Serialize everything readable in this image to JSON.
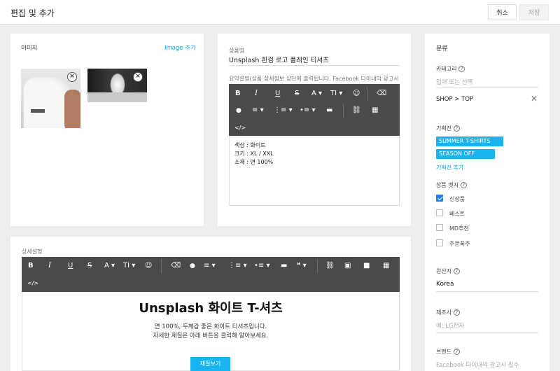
{
  "header": {
    "title": "편집 및 추가",
    "cancel_label": "취소",
    "save_label": "저장"
  },
  "image_card": {
    "title": "이미지",
    "add_link": "Image 추가"
  },
  "product": {
    "name_label": "상품명",
    "name_value": "Unsplash 흰검 로고 플레인 티셔츠",
    "summary_label": "요약설명(상품 상세정보 상단에 출력됩니다. Facebook 다이내믹 광고시",
    "summary_lines": [
      "색상 : 화이트",
      "크기 : XL / XXL",
      "소재 : 면 100%"
    ]
  },
  "toolbar": {
    "bold": "B",
    "italic": "I",
    "underline": "U",
    "strike": "S",
    "font_color": "A",
    "text_size": "TI",
    "emoji": "☺",
    "eraser": "⌫",
    "drop": "●",
    "align": "≡",
    "ordered_list": "⋮≡",
    "bullet_list": "•≡",
    "hr": "▬",
    "quote": "❝",
    "link": "⛓",
    "image": "▣",
    "video": "■",
    "table": "▦",
    "code": "</>"
  },
  "side": {
    "title": "분류",
    "category_label": "카테고리",
    "category_placeholder": "입력 또는 선택",
    "category_value": "SHOP > TOP",
    "event_label": "기획전",
    "event_tags": [
      "SUMMER T-SHIRTS",
      "SEASON OFF"
    ],
    "event_add": "기획전 추가",
    "badge_label": "상품 뱃지",
    "badges": [
      {
        "label": "신상품",
        "checked": true
      },
      {
        "label": "베스트",
        "checked": false
      },
      {
        "label": "MD추천",
        "checked": false
      },
      {
        "label": "주문폭주",
        "checked": false
      }
    ],
    "origin_label": "원산지",
    "origin_value": "Korea",
    "maker_label": "제조사",
    "maker_placeholder": "예: LG전자",
    "brand_label": "브랜드",
    "brand_placeholder": "Facebook 다이내믹 광고시 필수"
  },
  "description": {
    "label": "상세설명",
    "heading": "Unsplash 화이트 T-셔츠",
    "lines": [
      "면 100%, 두께감 좋은 화이트 티셔츠입니다.",
      "자세한 재질은 아래 버튼을 클릭해 알아보세요."
    ],
    "cta": "재질보기"
  },
  "colors": {
    "accent": "#18b4f2",
    "toolbar": "#4a4a4a",
    "link": "#1aa3e8"
  }
}
